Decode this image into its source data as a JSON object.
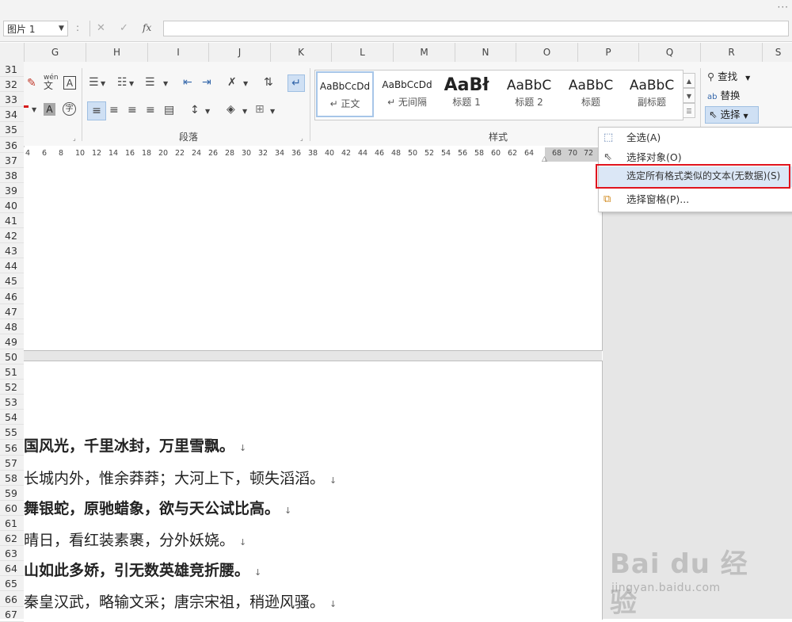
{
  "window": {
    "menu_dots": "···"
  },
  "formula_bar": {
    "name_box": "图片 1",
    "separator": ":",
    "cancel_glyph": "✕",
    "enter_glyph": "✓",
    "fx_label": "fx",
    "value": ""
  },
  "columns": [
    "G",
    "H",
    "I",
    "J",
    "K",
    "L",
    "M",
    "N",
    "O",
    "P",
    "Q",
    "R",
    "S"
  ],
  "rows": [
    "31",
    "32",
    "33",
    "34",
    "35",
    "36",
    "37",
    "38",
    "39",
    "40",
    "41",
    "42",
    "43",
    "44",
    "45",
    "46",
    "47",
    "48",
    "49",
    "50",
    "51",
    "52",
    "53",
    "54",
    "55",
    "56",
    "57",
    "58",
    "59",
    "60",
    "61",
    "62",
    "63",
    "64",
    "65",
    "66",
    "67"
  ],
  "ribbon": {
    "paragraph_label": "段落",
    "styles_label": "样式",
    "styles": [
      {
        "sample": "AaBbCcDd",
        "name": "↵ 正文"
      },
      {
        "sample": "AaBbCcDd",
        "name": "↵ 无间隔"
      },
      {
        "sample": "AaBł",
        "name": "标题 1"
      },
      {
        "sample": "AaBbC",
        "name": "标题 2"
      },
      {
        "sample": "AaBbC",
        "name": "标题"
      },
      {
        "sample": "AaBbC",
        "name": "副标题"
      }
    ],
    "find_label": "查找",
    "replace_label": "替换",
    "select_label": "选择",
    "phonetic_top": "wén",
    "phonetic_char": "文",
    "char_border": "A",
    "char_shading": "A",
    "enclose_char": "字"
  },
  "ruler_ticks": [
    "4",
    "6",
    "8",
    "10",
    "12",
    "14",
    "16",
    "18",
    "20",
    "22",
    "24",
    "26",
    "28",
    "30",
    "32",
    "34",
    "36",
    "38",
    "40",
    "42",
    "44",
    "46",
    "48",
    "50",
    "52",
    "54",
    "56",
    "58",
    "60",
    "62",
    "64",
    "68",
    "70",
    "72"
  ],
  "select_menu": {
    "items": [
      {
        "label": "全选(A)",
        "icon": "select-all-icon"
      },
      {
        "label": "选择对象(O)",
        "icon": "select-objects-icon"
      },
      {
        "label": "选定所有格式类似的文本(无数据)(S)",
        "icon": "select-similar-icon"
      },
      {
        "label": "选择窗格(P)...",
        "icon": "selection-pane-icon"
      }
    ]
  },
  "document": {
    "lines": [
      {
        "text": "国风光，千里冰封，万里雪飘。",
        "bold": true
      },
      {
        "text": "长城内外，惟余莽莽；大河上下，顿失滔滔。",
        "bold": false
      },
      {
        "text": "舞银蛇，原驰蜡象，欲与天公试比高。",
        "bold": true
      },
      {
        "text": "晴日，看红装素裹，分外妖娆。",
        "bold": false
      },
      {
        "text": "山如此多娇，引无数英雄竞折腰。",
        "bold": true
      },
      {
        "text": "秦皇汉武，略输文采；唐宗宋祖，稍逊风骚。",
        "bold": false
      }
    ],
    "para_mark": "↓"
  },
  "watermark": {
    "brand": "Bai du 经验",
    "url": "jingyan.baidu.com"
  }
}
